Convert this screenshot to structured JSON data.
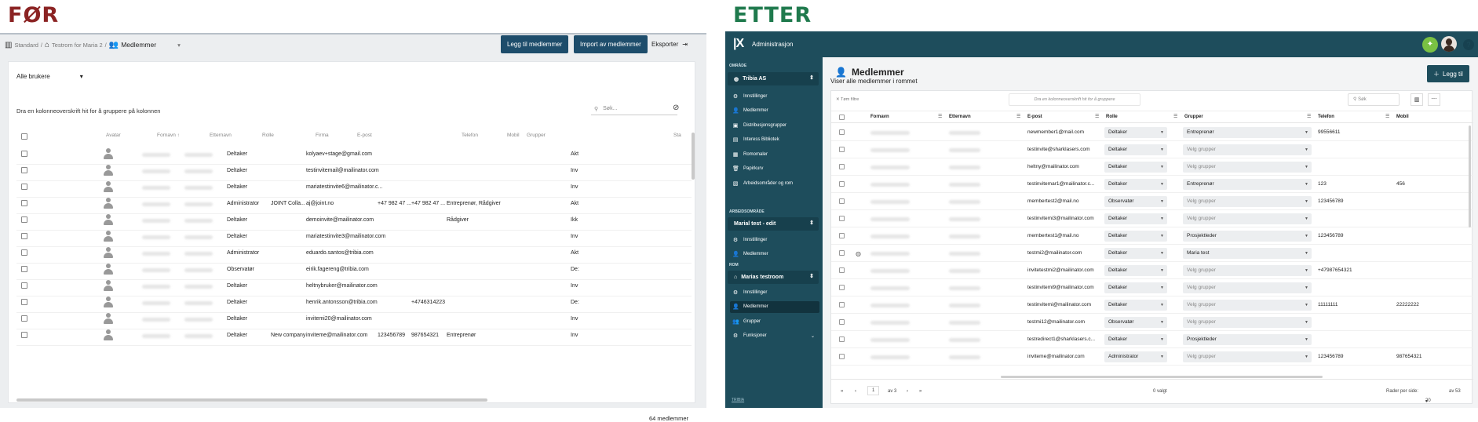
{
  "labels": {
    "before": "FØR",
    "after": "ETTER"
  },
  "colors": {
    "before_label": "#8b2323",
    "after_label": "#1f7a4d",
    "brand_dark": "#1e4d5c",
    "button_blue": "#1e4d6b"
  },
  "before": {
    "breadcrumb": {
      "root": "Standard",
      "home_target": "Testrom for Maria 2",
      "current": "Medlemmer"
    },
    "buttons": {
      "add": "Legg til medlemmer",
      "import": "Import av medlemmer",
      "export": "Eksporter"
    },
    "filter": {
      "value": "Alle brukere"
    },
    "group_hint": "Dra en kolonneoverskrift hit for å gruppere på kolonnen",
    "search_placeholder": "Søk...",
    "columns": [
      "Avatar",
      "Fornavn",
      "Etternavn",
      "Rolle",
      "Firma",
      "E-post",
      "Telefon",
      "Mobil",
      "Grupper",
      "Sta"
    ],
    "rows": [
      {
        "rolle": "Deltaker",
        "firma": "",
        "epost": "kolyaev+stage@gmail.com",
        "telefon": "",
        "mobil": "",
        "grupper": "",
        "status": "Akt"
      },
      {
        "rolle": "Deltaker",
        "firma": "",
        "epost": "testinvitemail@mailinator.com",
        "telefon": "",
        "mobil": "",
        "grupper": "",
        "status": "Inv"
      },
      {
        "rolle": "Deltaker",
        "firma": "",
        "epost": "mariatestinvite6@mailinator.c...",
        "telefon": "",
        "mobil": "",
        "grupper": "",
        "status": "Inv"
      },
      {
        "rolle": "Administrator",
        "firma": "JOINT Colla...",
        "epost": "aj@joint.no",
        "telefon": "+47 982 47 ...",
        "mobil": "+47 982 47 ...",
        "grupper": "Entreprenør, Rådgiver",
        "status": "Akt"
      },
      {
        "rolle": "Deltaker",
        "firma": "",
        "epost": "demoinvite@mailinator.com",
        "telefon": "",
        "mobil": "",
        "grupper": "Rådgiver",
        "status": "Ikk"
      },
      {
        "rolle": "Deltaker",
        "firma": "",
        "epost": "mariatestinvite3@mailinator.com",
        "telefon": "",
        "mobil": "",
        "grupper": "",
        "status": "Inv"
      },
      {
        "rolle": "Administrator",
        "firma": "",
        "epost": "eduardo.santos@tribia.com",
        "telefon": "",
        "mobil": "",
        "grupper": "",
        "status": "Akt"
      },
      {
        "rolle": "Observatør",
        "firma": "",
        "epost": "eirik.fagereng@tribia.com",
        "telefon": "",
        "mobil": "",
        "grupper": "",
        "status": "De:"
      },
      {
        "rolle": "Deltaker",
        "firma": "",
        "epost": "heltnybruker@mailinator.com",
        "telefon": "",
        "mobil": "",
        "grupper": "",
        "status": "Inv"
      },
      {
        "rolle": "Deltaker",
        "firma": "",
        "epost": "henrik.antonsson@tribia.com",
        "telefon": "",
        "mobil": "+4746314223",
        "grupper": "",
        "status": "De:"
      },
      {
        "rolle": "Deltaker",
        "firma": "",
        "epost": "invitemi20@mailinator.com",
        "telefon": "",
        "mobil": "",
        "grupper": "",
        "status": "Inv"
      },
      {
        "rolle": "Deltaker",
        "firma": "New company",
        "epost": "inviteme@mailinator.com",
        "telefon": "123456789",
        "mobil": "987654321",
        "grupper": "Entreprenør",
        "status": "Inv"
      }
    ],
    "count": "64 medlemmer"
  },
  "after": {
    "app_title": "Administrasjon",
    "sidebar": {
      "section_area": "OMRÅDE",
      "area_name": "Tribia AS",
      "area_items": [
        "Innstillinger",
        "Medlemmer",
        "Distribusjonsgrupper",
        "Interess Bibliotek",
        "Romomaler",
        "Papirkurv",
        "Arbeidsområder og rom"
      ],
      "section_workspace": "ARBEIDSOMRÅDE",
      "workspace_name": "Marial test - edit",
      "workspace_items": [
        "Innstillinger",
        "Medlemmer"
      ],
      "section_room": "ROM",
      "room_name": "Marias testroom",
      "room_items": [
        "Innstillinger",
        "Medlemmer",
        "Grupper",
        "Funksjoner"
      ],
      "footer": "TRIBIA"
    },
    "page_title": "Medlemmer",
    "subtitle": "Viser alle medlemmer i rommet",
    "add_button": "Legg til",
    "clear_filters": "Tøm filtre",
    "group_hint": "Dra en kolonneoverskrift hit for å gruppere",
    "search_placeholder": "Søk",
    "columns": [
      "Fornavn",
      "Etternavn",
      "E-post",
      "Rolle",
      "Grupper",
      "Telefon",
      "Mobil"
    ],
    "rows": [
      {
        "epost": "newmember1@mail.com",
        "rolle": "Deltaker",
        "grupper": "Entreprenør",
        "telefon": "99556611",
        "mobil": ""
      },
      {
        "epost": "testinvite@sharklasers.com",
        "rolle": "Deltaker",
        "grupper": "Velg grupper",
        "telefon": "",
        "mobil": ""
      },
      {
        "epost": "heltny@mailinator.com",
        "rolle": "Deltaker",
        "grupper": "Velg grupper",
        "telefon": "",
        "mobil": ""
      },
      {
        "epost": "testinvitemar1@mailinator.c...",
        "rolle": "Deltaker",
        "grupper": "Entreprenør",
        "telefon": "123",
        "mobil": "456"
      },
      {
        "epost": "membertest2@mail.no",
        "rolle": "Observatør",
        "grupper": "Velg grupper",
        "telefon": "123456789",
        "mobil": ""
      },
      {
        "epost": "testinvitemi3@mailinator.com",
        "rolle": "Deltaker",
        "grupper": "Velg grupper",
        "telefon": "",
        "mobil": ""
      },
      {
        "epost": "membertest1@mail.no",
        "rolle": "Deltaker",
        "grupper": "Prosjektleder",
        "telefon": "123456789",
        "mobil": ""
      },
      {
        "epost": "testmi2@mailinator.com",
        "rolle": "Deltaker",
        "grupper": "Maria test",
        "telefon": "",
        "mobil": ""
      },
      {
        "epost": "invitetestmi2@mailinator.com",
        "rolle": "Deltaker",
        "grupper": "Velg grupper",
        "telefon": "+47987654321",
        "mobil": ""
      },
      {
        "epost": "testinvitemi9@mailinator.com",
        "rolle": "Deltaker",
        "grupper": "Velg grupper",
        "telefon": "",
        "mobil": ""
      },
      {
        "epost": "testinvitemi@mailinator.com",
        "rolle": "Deltaker",
        "grupper": "Velg grupper",
        "telefon": "11111111",
        "mobil": "22222222"
      },
      {
        "epost": "testmi12@mailinator.com",
        "rolle": "Observatør",
        "grupper": "Velg grupper",
        "telefon": "",
        "mobil": ""
      },
      {
        "epost": "testredirect1@sharklasers.c...",
        "rolle": "Deltaker",
        "grupper": "Prosjektleder",
        "telefon": "",
        "mobil": ""
      },
      {
        "epost": "inviteme@mailinator.com",
        "rolle": "Administrator",
        "grupper": "Velg grupper",
        "telefon": "123456789",
        "mobil": "987654321"
      }
    ],
    "pagination": {
      "page": "1",
      "of_pages": "av 3",
      "selected": "0 valgt",
      "rows_per_page_label": "Rader per side:",
      "rows_per_page": "20",
      "of_total": "av 53"
    }
  }
}
